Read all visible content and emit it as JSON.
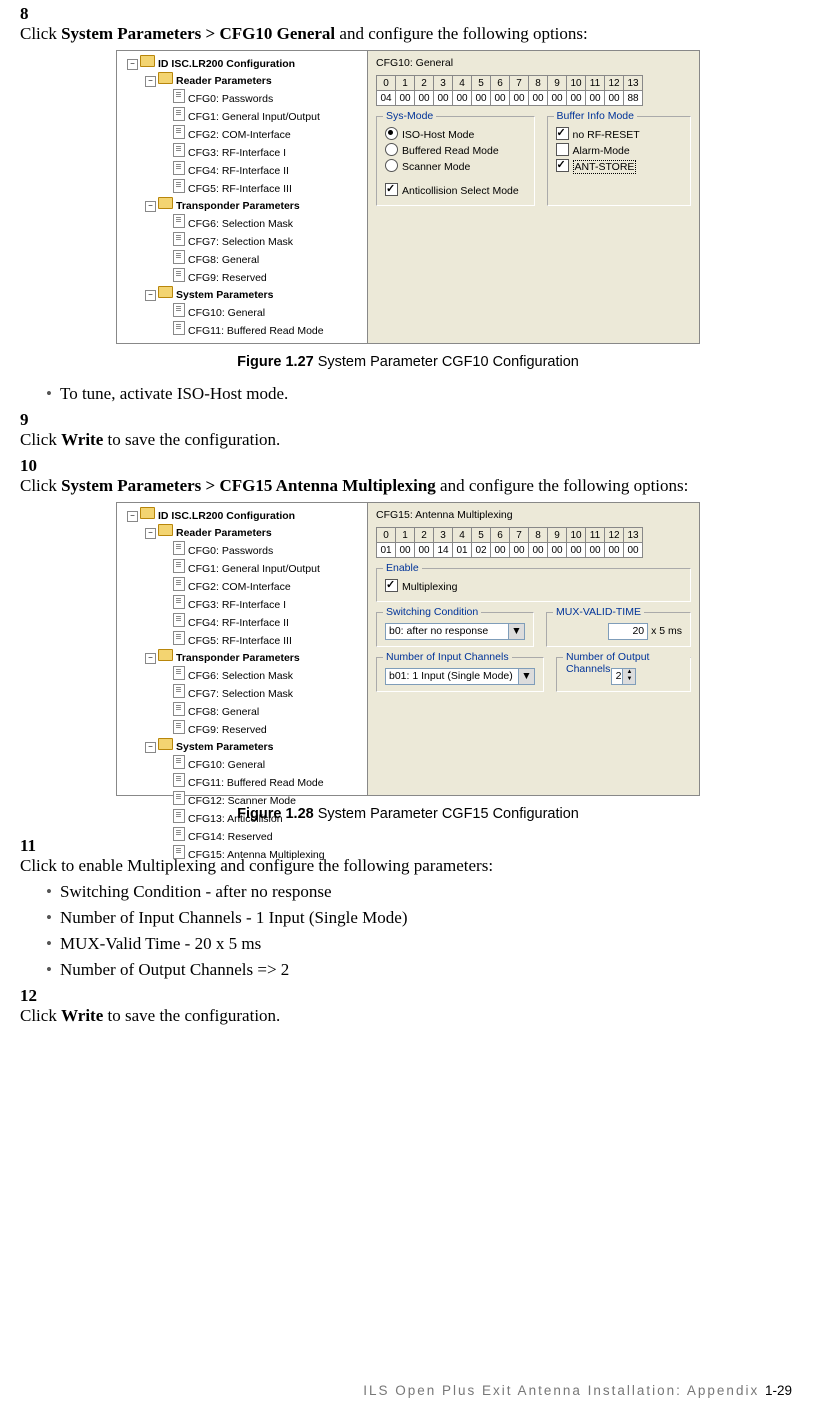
{
  "steps": {
    "s8": {
      "num": "8",
      "pre": "Click ",
      "bold": "System Parameters > CFG10 General",
      "post": " and configure the following options:"
    },
    "s9": {
      "num": "9",
      "pre": "Click ",
      "bold": "Write",
      "post": " to save the configuration."
    },
    "s10": {
      "num": "10",
      "pre": "Click ",
      "bold": "System Parameters > CFG15 Antenna Multiplexing",
      "post": " and configure the following options:"
    },
    "s11": {
      "num": "11",
      "text": "Click to enable Multiplexing and configure the following parameters:"
    },
    "s12": {
      "num": "12",
      "pre": "Click ",
      "bold": "Write",
      "post": " to save the configuration."
    }
  },
  "bullets": {
    "b0": "To tune, activate ISO-Host mode.",
    "b1": "Switching Condition - after no response",
    "b2": "Number of Input Channels - 1 Input (Single Mode)",
    "b3": "MUX-Valid Time - 20 x 5 ms",
    "b4": "Number of Output Channels => 2"
  },
  "captions": {
    "c1": {
      "bold": "Figure 1.27",
      "rest": " System Parameter CGF10 Configuration"
    },
    "c2": {
      "bold": "Figure 1.28",
      "rest": " System Parameter CGF15 Configuration"
    }
  },
  "tree": {
    "root": "ID ISC.LR200 Configuration",
    "reader": "Reader Parameters",
    "reader_items": {
      "i0": "CFG0: Passwords",
      "i1": "CFG1: General Input/Output",
      "i2": "CFG2: COM-Interface",
      "i3": "CFG3: RF-Interface I",
      "i4": "CFG4: RF-Interface II",
      "i5": "CFG5: RF-Interface III"
    },
    "transponder": "Transponder Parameters",
    "transponder_items": {
      "i0": "CFG6: Selection Mask",
      "i1": "CFG7: Selection Mask",
      "i2": "CFG8: General",
      "i3": "CFG9: Reserved"
    },
    "system": "System Parameters",
    "system_items_a": {
      "i0": "CFG10: General",
      "i1": "CFG11: Buffered Read Mode"
    },
    "system_items_b": {
      "i0": "CFG10: General",
      "i1": "CFG11: Buffered Read Mode",
      "i2": "CFG12: Scanner Mode",
      "i3": "CFG13: Anticollision",
      "i4": "CFG14: Reserved",
      "i5": "CFG15: Antenna Multiplexing"
    }
  },
  "panelA": {
    "title": "CFG10: General",
    "bytes_hdr": "0 1 2 3 4 5 6 7 8 9 10 11 12 13",
    "bytes_val": "04 00 00 00 00 00 00 00 00 00 00 00 00 88",
    "sys_mode": {
      "title": "Sys-Mode",
      "o0": "ISO-Host Mode",
      "o1": "Buffered Read Mode",
      "o2": "Scanner Mode",
      "o3": "Anticollision Select Mode"
    },
    "buf": {
      "title": "Buffer Info Mode",
      "o0": "no RF-RESET",
      "o1": "Alarm-Mode",
      "o2": "ANT-STORE"
    }
  },
  "panelB": {
    "title": "CFG15: Antenna Multiplexing",
    "bytes_hdr": "0 1 2 3 4 5 6 7 8 9 10 11 12 13",
    "bytes_val": "01 00 00 14 01 02 00 00 00 00 00 00 00 00",
    "enable": {
      "title": "Enable",
      "o0": "Multiplexing"
    },
    "sw": {
      "title": "Switching Condition",
      "val": "b0: after no response"
    },
    "mux": {
      "title": "MUX-VALID-TIME",
      "val": "20",
      "unit": " x 5 ms"
    },
    "nin": {
      "title": "Number of Input Channels",
      "val": "b01: 1 Input (Single Mode)"
    },
    "nout": {
      "title": "Number of Output Channels",
      "val": "2"
    }
  },
  "footer": {
    "text": "ILS Open Plus Exit Antenna Installation: Appendix",
    "page": "1-29"
  }
}
